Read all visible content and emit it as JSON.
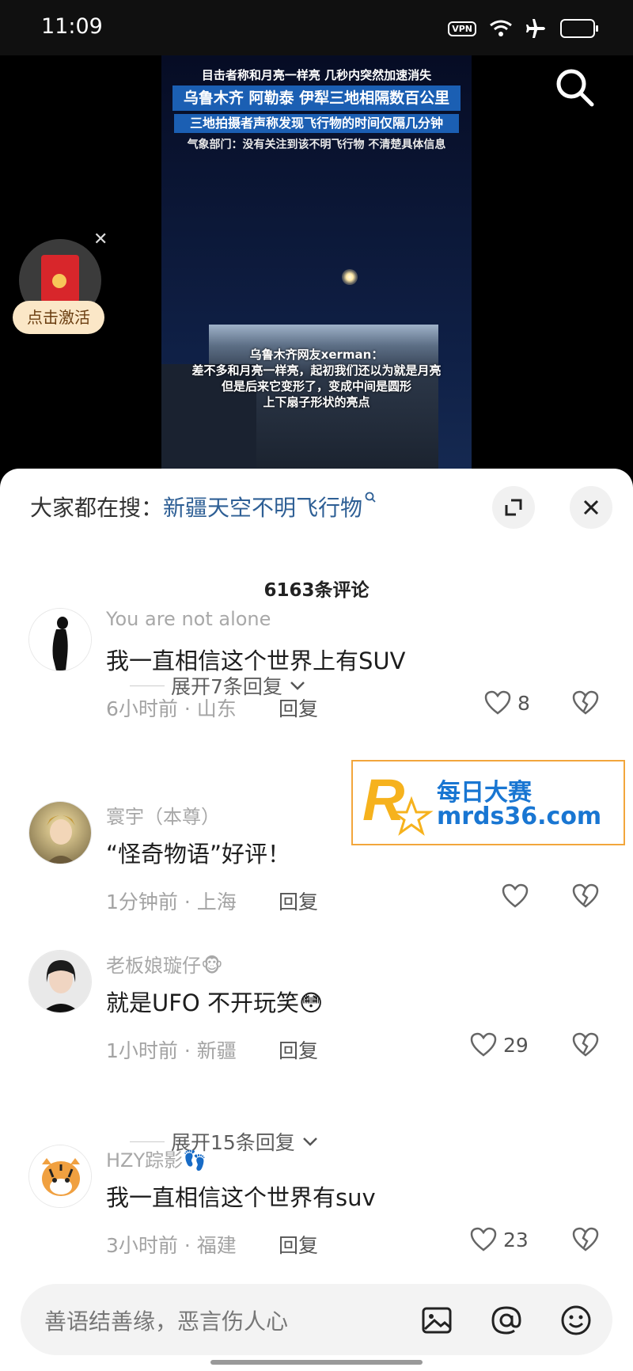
{
  "status_bar": {
    "time": "11:09",
    "vpn": "VPN"
  },
  "video": {
    "headline_lines": [
      "目击者称和月亮一样亮 几秒内突然加速消失",
      "乌鲁木齐 阿勒泰 伊犁三地相隔数百公里",
      "三地拍摄者声称发现飞行物的时间仅隔几分钟",
      "气象部门：没有关注到该不明飞行物 不清楚具体信息"
    ],
    "caption_lines": [
      "乌鲁木齐网友xerman：",
      "差不多和月亮一样亮，起初我们还以为就是月亮",
      "但是后来它变形了，变成中间是圆形",
      "上下扇子形状的亮点"
    ]
  },
  "promo": {
    "activate_label": "点击激活"
  },
  "sheet": {
    "trending_prefix": "大家都在搜：",
    "trending_term": "新疆天空不明飞行物",
    "comment_count": "6163条评论"
  },
  "comments": [
    {
      "user": "You are not alone",
      "text": "我一直相信这个世界上有SUV",
      "meta": "6小时前 · 山东",
      "reply": "回复",
      "likes": "8",
      "expand": "展开7条回复"
    },
    {
      "user": "寰宇（本尊）",
      "text": "“怪奇物语”好评！",
      "meta": "1分钟前 · 上海",
      "reply": "回复",
      "likes": ""
    },
    {
      "user": "老板娘璇仔🐵",
      "text": "就是UFO 不开玩笑😳",
      "meta": "1小时前 · 新疆",
      "reply": "回复",
      "likes": "29",
      "expand": "展开15条回复"
    },
    {
      "user": "HZY踪影👣",
      "text": "我一直相信这个世界有suv",
      "meta": "3小时前 · 福建",
      "reply": "回复",
      "likes": "23"
    }
  ],
  "watermark": {
    "line1": "每日大赛",
    "line2": "mrds36.com"
  },
  "input": {
    "placeholder": "善语结善缘，恶言伤人心"
  }
}
